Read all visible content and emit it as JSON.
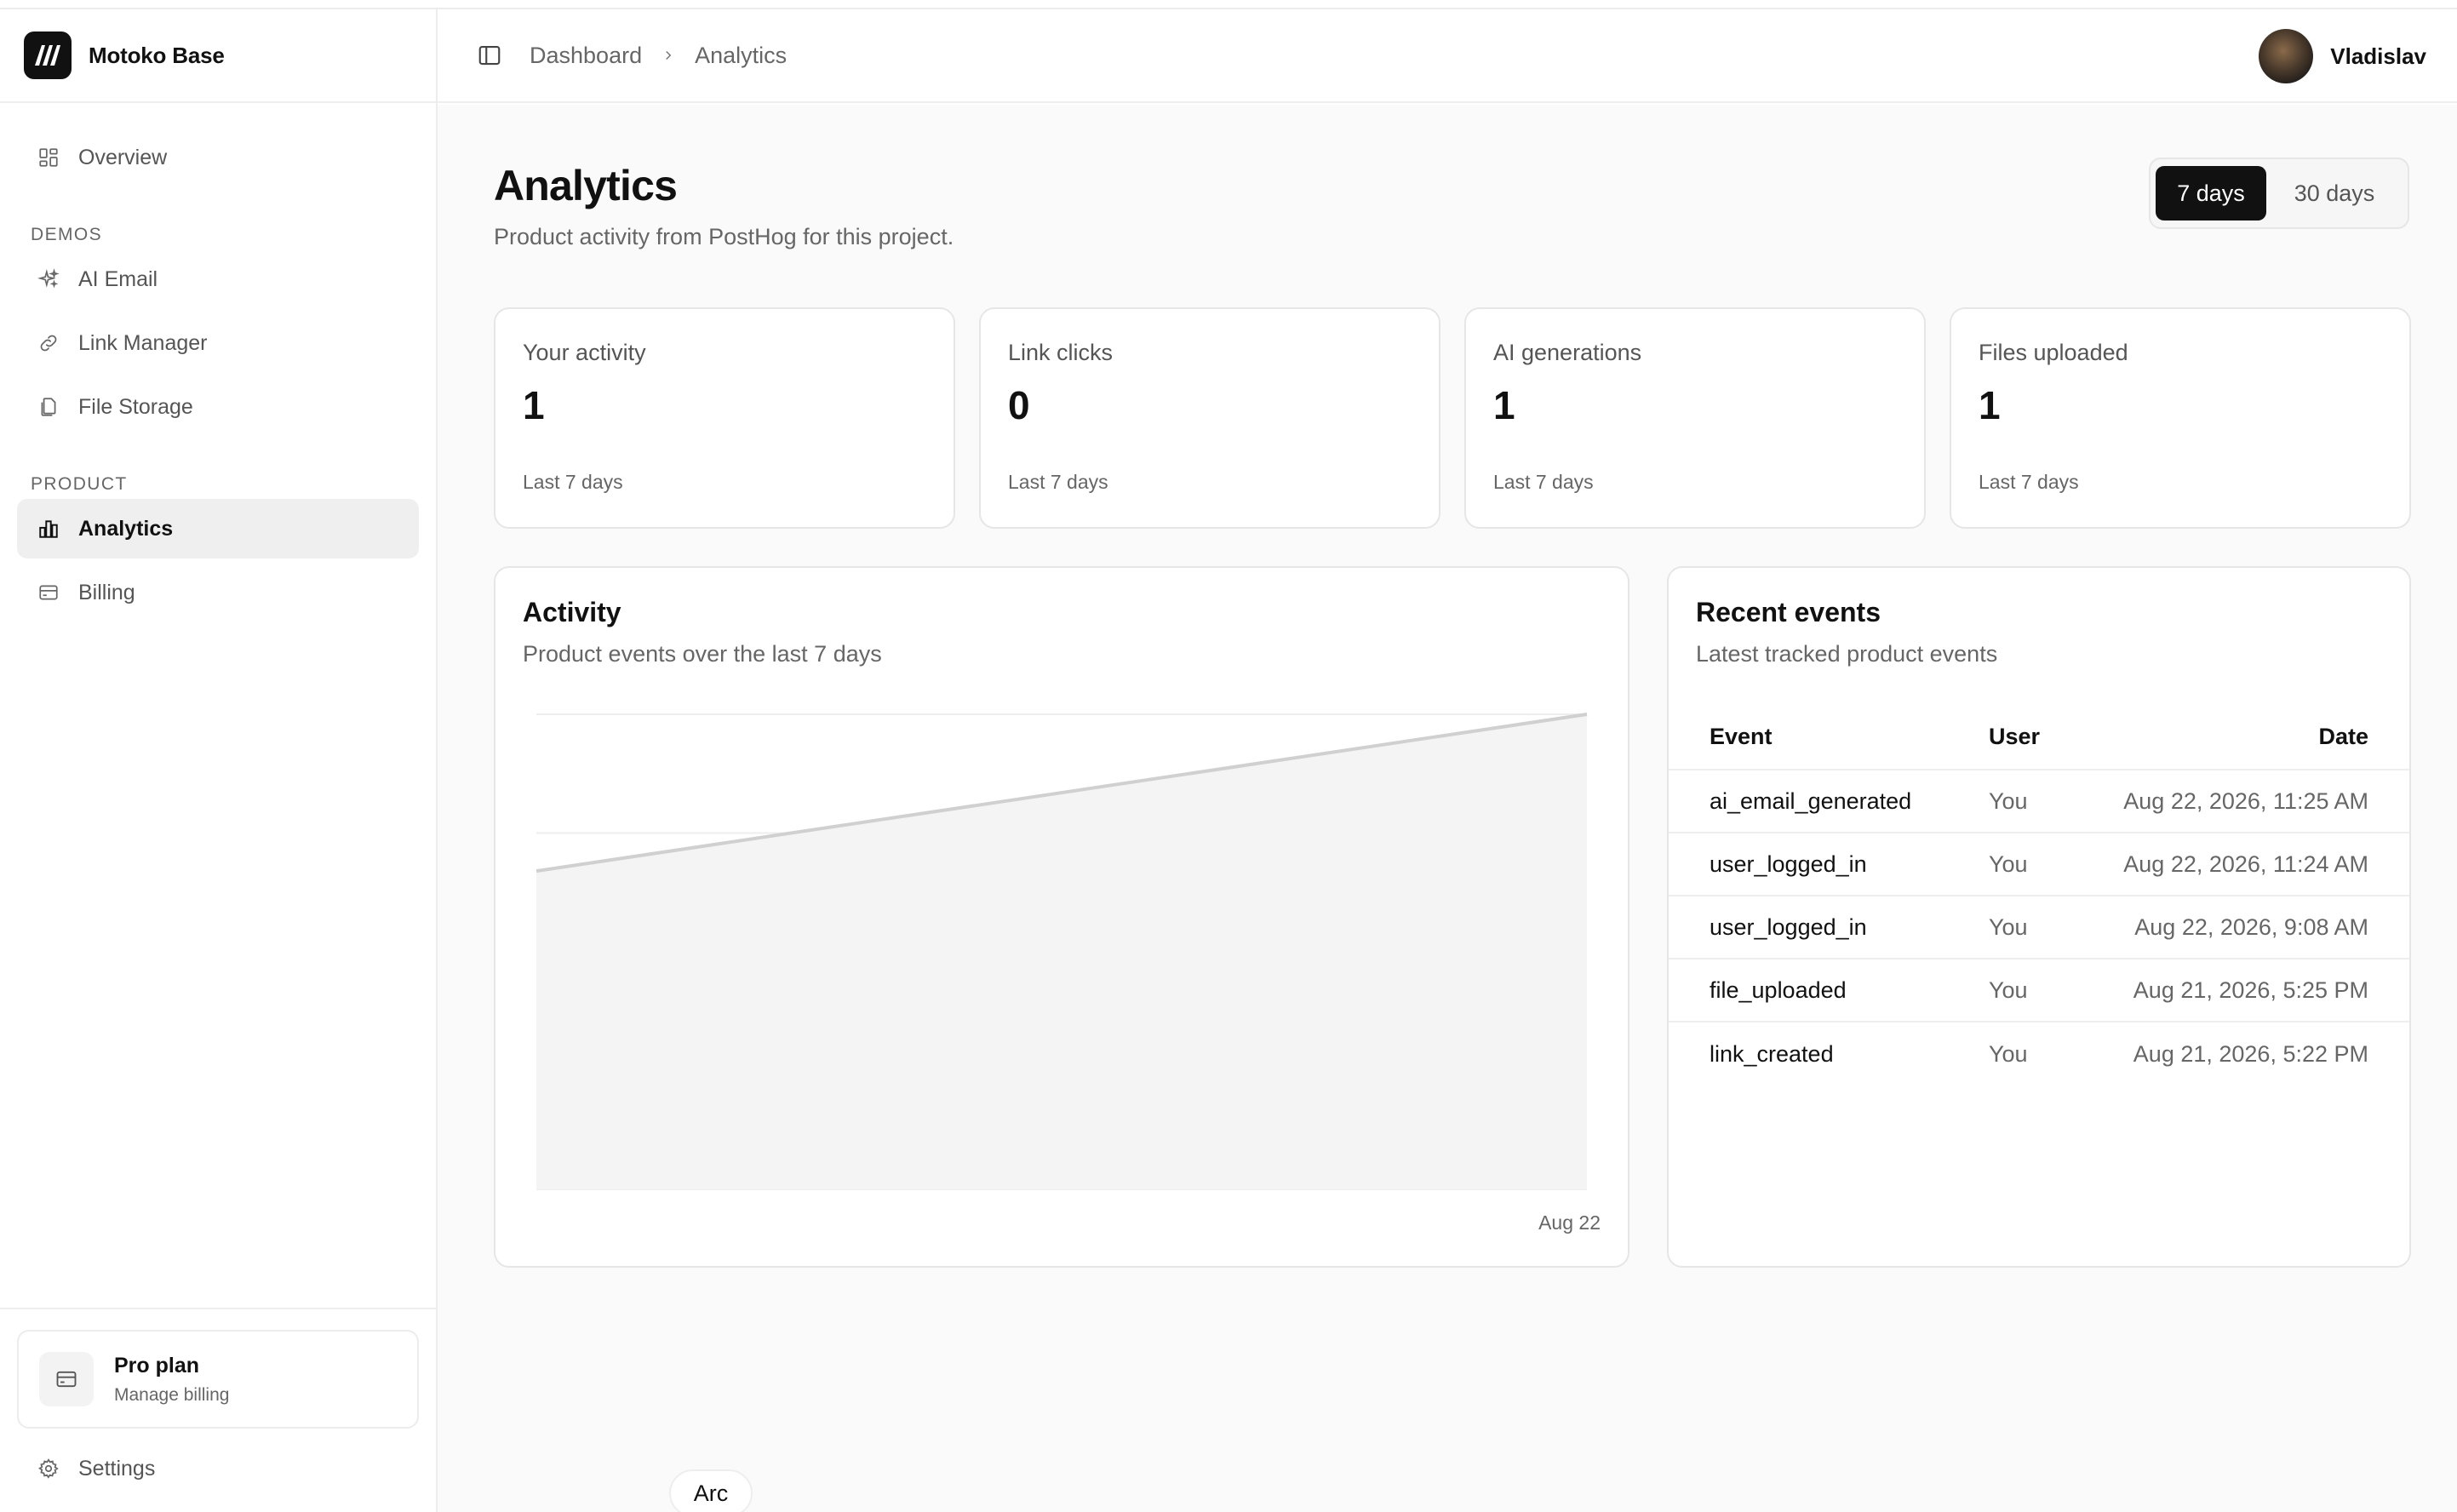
{
  "brand": {
    "name": "Motoko Base"
  },
  "sidebar": {
    "overview": "Overview",
    "section_demos": "DEMOS",
    "ai_email": "AI Email",
    "link_manager": "Link Manager",
    "file_storage": "File Storage",
    "section_product": "PRODUCT",
    "analytics": "Analytics",
    "billing": "Billing",
    "plan_title": "Pro plan",
    "plan_sub": "Manage billing",
    "settings": "Settings"
  },
  "header": {
    "breadcrumb_root": "Dashboard",
    "breadcrumb_current": "Analytics",
    "user_name": "Vladislav"
  },
  "page": {
    "title": "Analytics",
    "subtitle": "Product activity from PostHog for this project.",
    "range_7": "7 days",
    "range_30": "30 days"
  },
  "stats": [
    {
      "label": "Your activity",
      "value": "1",
      "period": "Last 7 days"
    },
    {
      "label": "Link clicks",
      "value": "0",
      "period": "Last 7 days"
    },
    {
      "label": "AI generations",
      "value": "1",
      "period": "Last 7 days"
    },
    {
      "label": "Files uploaded",
      "value": "1",
      "period": "Last 7 days"
    }
  ],
  "activity": {
    "title": "Activity",
    "subtitle": "Product events over the last 7 days"
  },
  "chart_data": {
    "type": "area",
    "x": [
      "",
      "Aug 22"
    ],
    "series": [
      {
        "values": [
          0.67,
          1
        ]
      }
    ],
    "ylim": [
      0,
      1
    ],
    "grid": true,
    "xlabel": "",
    "ylabel": "",
    "x_tick_labels": [
      "Aug 22"
    ],
    "colors": {
      "line": "#d0d0d0",
      "fill": "#f4f4f4"
    }
  },
  "recent": {
    "title": "Recent events",
    "subtitle": "Latest tracked product events",
    "columns": {
      "event": "Event",
      "user": "User",
      "date": "Date"
    },
    "rows": [
      {
        "event": "ai_email_generated",
        "user": "You",
        "date": "Aug 22, 2026, 11:25 AM"
      },
      {
        "event": "user_logged_in",
        "user": "You",
        "date": "Aug 22, 2026, 11:24 AM"
      },
      {
        "event": "user_logged_in",
        "user": "You",
        "date": "Aug 22, 2026, 9:08 AM"
      },
      {
        "event": "file_uploaded",
        "user": "You",
        "date": "Aug 21, 2026, 5:25 PM"
      },
      {
        "event": "link_created",
        "user": "You",
        "date": "Aug 21, 2026, 5:22 PM"
      }
    ]
  },
  "browser": {
    "arc_label": "Arc"
  }
}
